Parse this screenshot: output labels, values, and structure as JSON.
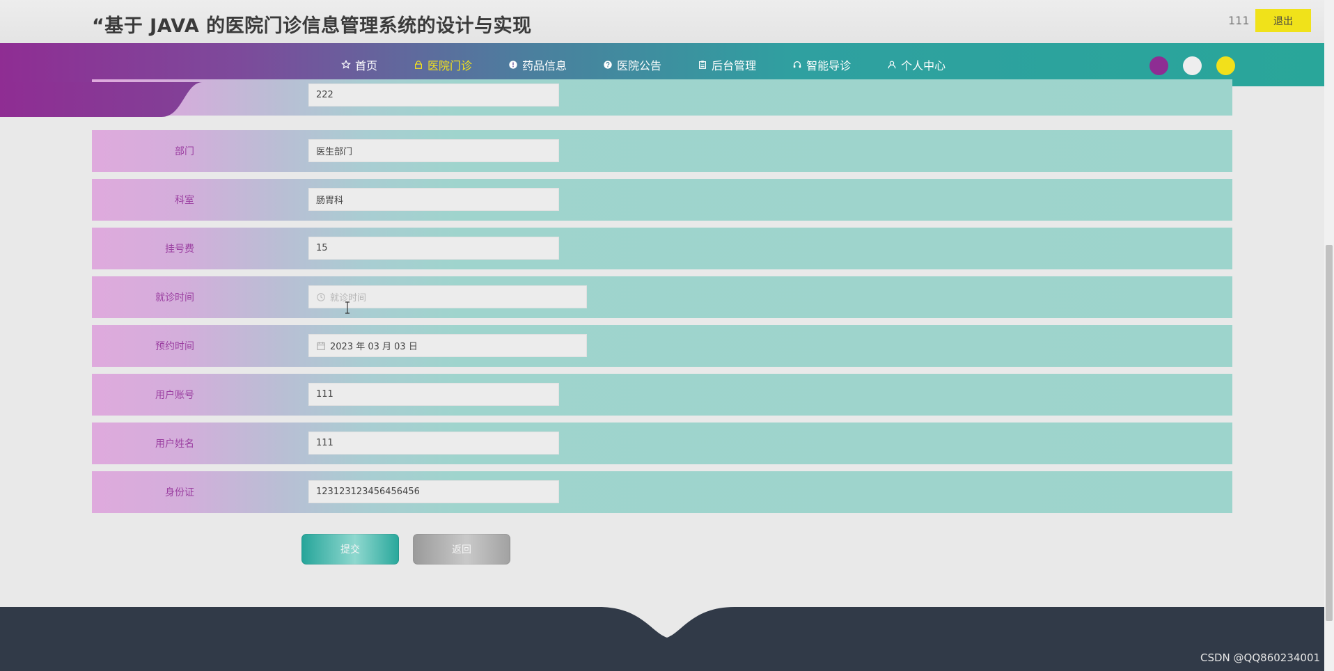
{
  "header": {
    "title": "“基于 JAVA 的医院门诊信息管理系统的设计与实现",
    "username": "111",
    "logout_label": "退出"
  },
  "nav": {
    "items": [
      {
        "label": "首页",
        "icon": "star-icon",
        "active": false
      },
      {
        "label": "医院门诊",
        "icon": "lock-icon",
        "active": true
      },
      {
        "label": "药品信息",
        "icon": "info-icon",
        "active": false
      },
      {
        "label": "医院公告",
        "icon": "question-icon",
        "active": false
      },
      {
        "label": "后台管理",
        "icon": "clipboard-icon",
        "active": false
      },
      {
        "label": "智能导诊",
        "icon": "headset-icon",
        "active": false
      },
      {
        "label": "个人中心",
        "icon": "user-icon",
        "active": false
      }
    ],
    "active_color": "#f4e31c",
    "theme_colors": [
      "#8e2d93",
      "#eeeeee",
      "#f2e01b"
    ]
  },
  "form": {
    "rows": [
      {
        "label": "",
        "value": "222"
      },
      {
        "label": "部门",
        "value": "医生部门"
      },
      {
        "label": "科室",
        "value": "肠胃科"
      },
      {
        "label": "挂号费",
        "value": "15"
      },
      {
        "label": "就诊时间",
        "value": "",
        "placeholder": "就诊时间",
        "icon": "clock-icon"
      },
      {
        "label": "预约时间",
        "value": "2023 年 03 月 03 日",
        "icon": "calendar-icon"
      },
      {
        "label": "用户账号",
        "value": "111"
      },
      {
        "label": "用户姓名",
        "value": "111"
      },
      {
        "label": "身份证",
        "value": "123123123456456456"
      }
    ]
  },
  "actions": {
    "submit_label": "提交",
    "back_label": "返回"
  },
  "watermark": "CSDN @QQ860234001",
  "colors": {
    "nav_start": "#8f2d93",
    "nav_end": "#29a69a",
    "label": "#9b3fa1",
    "footer": "#313a48"
  }
}
